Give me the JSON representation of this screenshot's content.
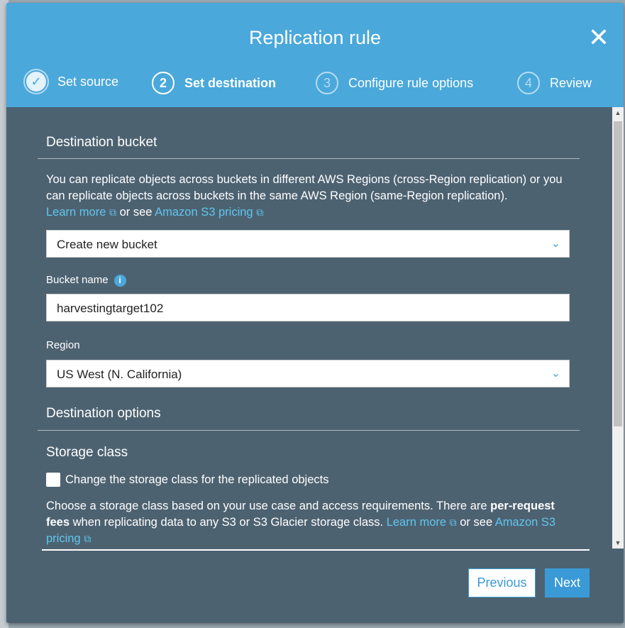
{
  "modal": {
    "title": "Replication rule",
    "close_icon": "close-icon"
  },
  "steps": [
    {
      "label": "Set source",
      "marker": "✓",
      "state": "done"
    },
    {
      "label": "Set destination",
      "marker": "2",
      "state": "active"
    },
    {
      "label": "Configure rule options",
      "marker": "3",
      "state": "pending"
    },
    {
      "label": "Review",
      "marker": "4",
      "state": "pending"
    }
  ],
  "destination_bucket": {
    "heading": "Destination bucket",
    "desc": "You can replicate objects across buckets in different AWS Regions (cross-Region replication) or you can replicate objects across buckets in the same AWS Region (same-Region replication).",
    "learn_more": "Learn more",
    "or_see": "or see",
    "pricing": "Amazon S3 pricing",
    "bucket_select": "Create new bucket",
    "bucket_name_label": "Bucket name",
    "bucket_name_value": "harvestingtarget102",
    "region_label": "Region",
    "region_value": "US West (N. California)"
  },
  "destination_options": {
    "heading": "Destination options",
    "storage_heading": "Storage class",
    "checkbox_label": "Change the storage class for the replicated objects",
    "desc_1": "Choose a storage class based on your use case and access requirements. There are ",
    "desc_bold": "per-request fees",
    "desc_2": " when replicating data to any S3 or S3 Glacier storage class. ",
    "learn_more": "Learn more",
    "or": " or see ",
    "pricing": "Amazon S3 pricing"
  },
  "footer": {
    "previous": "Previous",
    "next": "Next"
  },
  "colors": {
    "header": "#4aa8db",
    "body": "#4d6271",
    "link": "#5fc7ee",
    "primary": "#3a9ad6"
  }
}
